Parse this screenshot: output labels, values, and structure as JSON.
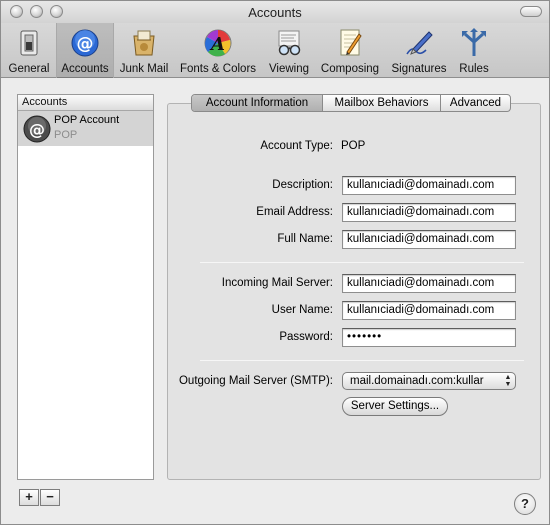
{
  "window": {
    "title": "Accounts"
  },
  "toolbar": {
    "items": [
      {
        "label": "General",
        "icon": "switch-icon"
      },
      {
        "label": "Accounts",
        "icon": "at-sign-icon"
      },
      {
        "label": "Junk Mail",
        "icon": "junk-mail-icon"
      },
      {
        "label": "Fonts & Colors",
        "icon": "color-wheel-icon"
      },
      {
        "label": "Viewing",
        "icon": "glasses-icon"
      },
      {
        "label": "Composing",
        "icon": "pencil-paper-icon"
      },
      {
        "label": "Signatures",
        "icon": "pen-signature-icon"
      },
      {
        "label": "Rules",
        "icon": "rules-arrows-icon"
      }
    ],
    "selected": "Accounts"
  },
  "accounts": {
    "header": "Accounts",
    "items": [
      {
        "name": "POP Account",
        "type": "POP"
      }
    ]
  },
  "tabs": [
    {
      "label": "Account Information",
      "active": true
    },
    {
      "label": "Mailbox Behaviors",
      "active": false
    },
    {
      "label": "Advanced",
      "active": false
    }
  ],
  "form": {
    "account_type_label": "Account Type:",
    "account_type_value": "POP",
    "description_label": "Description:",
    "description_value": "kullanıciadi@domainadı.com",
    "email_label": "Email Address:",
    "email_value": "kullanıciadi@domainadı.com",
    "fullname_label": "Full Name:",
    "fullname_value": "kullanıciadi@domainadı.com",
    "incoming_label": "Incoming Mail Server:",
    "incoming_value": "kullanıciadi@domainadı.com",
    "username_label": "User Name:",
    "username_value": "kullanıciadi@domainadı.com",
    "password_label": "Password:",
    "password_value": "•••••••",
    "smtp_label": "Outgoing Mail Server (SMTP):",
    "smtp_value": "mail.domainadı.com:kullar",
    "server_settings_button": "Server Settings..."
  },
  "buttons": {
    "add": "+",
    "remove": "−",
    "help": "?"
  },
  "colors": {
    "window_bg": "#ececec",
    "selected_row": "#d4d4d4",
    "accent": "#1c5fcf"
  }
}
